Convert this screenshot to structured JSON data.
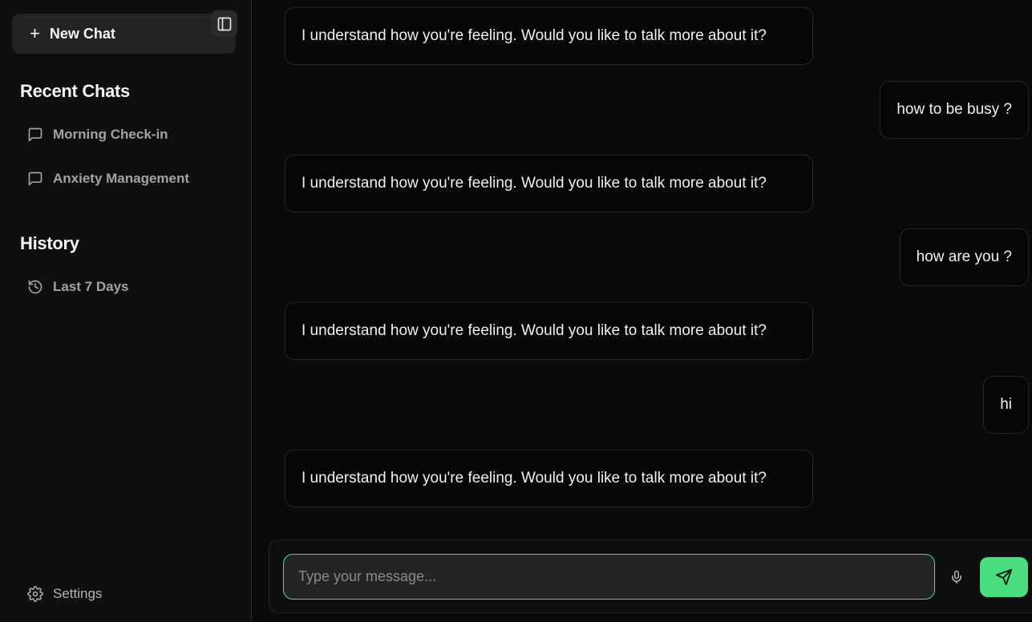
{
  "sidebar": {
    "new_chat_label": "New Chat",
    "recent_title": "Recent Chats",
    "recent_chats": [
      {
        "label": "Morning Check-in"
      },
      {
        "label": "Anxiety Management"
      }
    ],
    "history_title": "History",
    "history_items": [
      {
        "label": "Last 7 Days"
      }
    ],
    "settings_label": "Settings"
  },
  "messages": [
    {
      "role": "assistant",
      "text": "I understand how you're feeling. Would you like to talk more about it?"
    },
    {
      "role": "user",
      "text": "how to be busy ?"
    },
    {
      "role": "assistant",
      "text": "I understand how you're feeling. Would you like to talk more about it?"
    },
    {
      "role": "user",
      "text": "how are you ?"
    },
    {
      "role": "assistant",
      "text": "I understand how you're feeling. Would you like to talk more about it?"
    },
    {
      "role": "user",
      "text": "hi"
    },
    {
      "role": "assistant",
      "text": "I understand how you're feeling. Would you like to talk more about it?"
    }
  ],
  "composer": {
    "placeholder": "Type your message...",
    "value": ""
  },
  "colors": {
    "accent": "#4ade80",
    "background": "#0a0a0a",
    "sidebar": "#0f0f10"
  },
  "icons": {
    "new_chat": "plus-icon",
    "collapse": "sidebar-toggle-icon",
    "chat": "message-square-icon",
    "history": "history-icon",
    "settings": "gear-icon",
    "mic": "mic-icon",
    "send": "send-icon"
  }
}
